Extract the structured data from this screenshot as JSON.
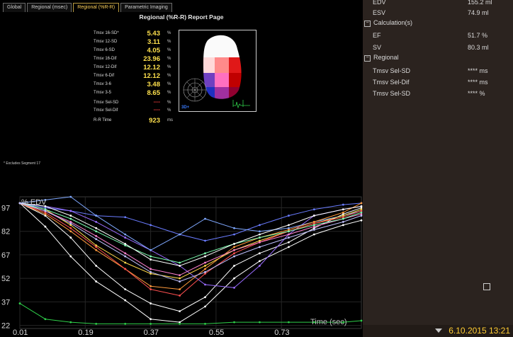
{
  "tabs": [
    "Global",
    "Regional (msec)",
    "Regional (%R-R)",
    "Parametric Imaging"
  ],
  "active_tab": 2,
  "report_title": "Regional (%R-R) Report Page",
  "metrics": [
    {
      "label": "Tmsv 16-SD*",
      "value": "5.43",
      "unit": "%"
    },
    {
      "label": "Tmsv 12-SD",
      "value": "3.11",
      "unit": "%"
    },
    {
      "label": "Tmsv 6-SD",
      "value": "4.05",
      "unit": "%"
    },
    {
      "label": "Tmsv 16-Dif",
      "value": "23.96",
      "unit": "%"
    },
    {
      "label": "Tmsv 12-Dif",
      "value": "12.12",
      "unit": "%"
    },
    {
      "label": "Tmsv 6-Dif",
      "value": "12.12",
      "unit": "%"
    },
    {
      "label": "Tmsv 3-6",
      "value": "3.48",
      "unit": "%"
    },
    {
      "label": "Tmsv 3-5",
      "value": "8.65",
      "unit": "%"
    }
  ],
  "sel_metrics": [
    {
      "label": "Tmsv Sel-SD",
      "value": "----",
      "unit": "%"
    },
    {
      "label": "Tmsv Sel-Dif",
      "value": "----",
      "unit": "%"
    }
  ],
  "rr_time": {
    "label": "R-R Time",
    "value": "923",
    "unit": "ms"
  },
  "footnote": "* Excludes Segment 17",
  "model_label": "3D+",
  "right_panel": {
    "edv": {
      "label": "EDV",
      "value": "155.2 ml"
    },
    "esv": {
      "label": "ESV",
      "value": "74.9 ml"
    },
    "calc_section": "Calculation(s)",
    "ef": {
      "label": "EF",
      "value": "51.7 %"
    },
    "sv": {
      "label": "SV",
      "value": "80.3 ml"
    },
    "regional_section": "Regional",
    "sel_sd": {
      "label": "Tmsv Sel-SD",
      "value": "**** ms"
    },
    "sel_dif": {
      "label": "Tmsv Sel-Dif",
      "value": "**** ms"
    },
    "sel_sd_pct": {
      "label": "Tmsv Sel-SD",
      "value": "**** %"
    }
  },
  "status_date": "6.10.2015 13:21",
  "colors": {
    "accent_yellow": "#ffe14d",
    "tab_active": "#ffd25a",
    "panel_bg": "#2b231f",
    "curve_green": "#2fd04a"
  },
  "chart_data": {
    "type": "line",
    "ylabel": "% EDV",
    "xlabel": "Time (sec)",
    "x_ticks": [
      "0.01",
      "0.19",
      "0.37",
      "0.55",
      "0.73"
    ],
    "y_ticks": [
      "97",
      "82",
      "67",
      "52",
      "37",
      "22"
    ],
    "xlim": [
      0.01,
      0.95
    ],
    "ylim": [
      20,
      104
    ],
    "grid": true,
    "x": [
      0.01,
      0.08,
      0.15,
      0.22,
      0.3,
      0.37,
      0.45,
      0.52,
      0.6,
      0.67,
      0.75,
      0.82,
      0.9,
      0.95
    ],
    "series": [
      {
        "color": "#ffffff",
        "values": [
          100,
          85,
          66,
          50,
          38,
          26,
          24,
          34,
          52,
          63,
          72,
          80,
          86,
          89
        ]
      },
      {
        "color": "#ffffff",
        "values": [
          100,
          92,
          78,
          60,
          45,
          36,
          31,
          40,
          60,
          68,
          75,
          84,
          93,
          97
        ]
      },
      {
        "color": "#6a7cff",
        "values": [
          100,
          97,
          95,
          92,
          91,
          86,
          80,
          76,
          80,
          86,
          92,
          96,
          99,
          100
        ]
      },
      {
        "color": "#9a6cff",
        "values": [
          100,
          98,
          95,
          88,
          78,
          70,
          60,
          48,
          46,
          60,
          80,
          92,
          96,
          98
        ]
      },
      {
        "color": "#7fa8ff",
        "values": [
          100,
          102,
          104,
          92,
          80,
          70,
          80,
          90,
          84,
          82,
          84,
          88,
          92,
          95
        ]
      },
      {
        "color": "#ff9a3c",
        "values": [
          100,
          93,
          82,
          70,
          58,
          47,
          45,
          58,
          72,
          78,
          83,
          88,
          94,
          100
        ]
      },
      {
        "color": "#ffd84a",
        "values": [
          100,
          96,
          86,
          73,
          62,
          55,
          52,
          60,
          70,
          76,
          82,
          87,
          92,
          96
        ]
      },
      {
        "color": "#ff5050",
        "values": [
          100,
          94,
          84,
          72,
          58,
          45,
          41,
          55,
          68,
          75,
          82,
          87,
          91,
          95
        ]
      },
      {
        "color": "#ff80d0",
        "values": [
          100,
          95,
          88,
          79,
          68,
          58,
          54,
          62,
          70,
          75,
          80,
          85,
          90,
          93
        ]
      },
      {
        "color": "#7cffb0",
        "values": [
          100,
          96,
          90,
          82,
          73,
          66,
          62,
          68,
          74,
          78,
          82,
          86,
          90,
          94
        ]
      },
      {
        "color": "#ffffff",
        "values": [
          100,
          98,
          92,
          84,
          74,
          64,
          60,
          66,
          74,
          80,
          86,
          92,
          96,
          98
        ]
      },
      {
        "color": "#c0c0ff",
        "values": [
          100,
          95,
          87,
          77,
          66,
          56,
          50,
          56,
          66,
          72,
          78,
          83,
          88,
          92
        ]
      },
      {
        "color": "#2fd04a",
        "values": [
          36,
          26,
          24,
          23,
          23,
          23,
          23,
          23,
          24,
          24,
          24,
          24,
          24,
          25
        ]
      }
    ]
  }
}
